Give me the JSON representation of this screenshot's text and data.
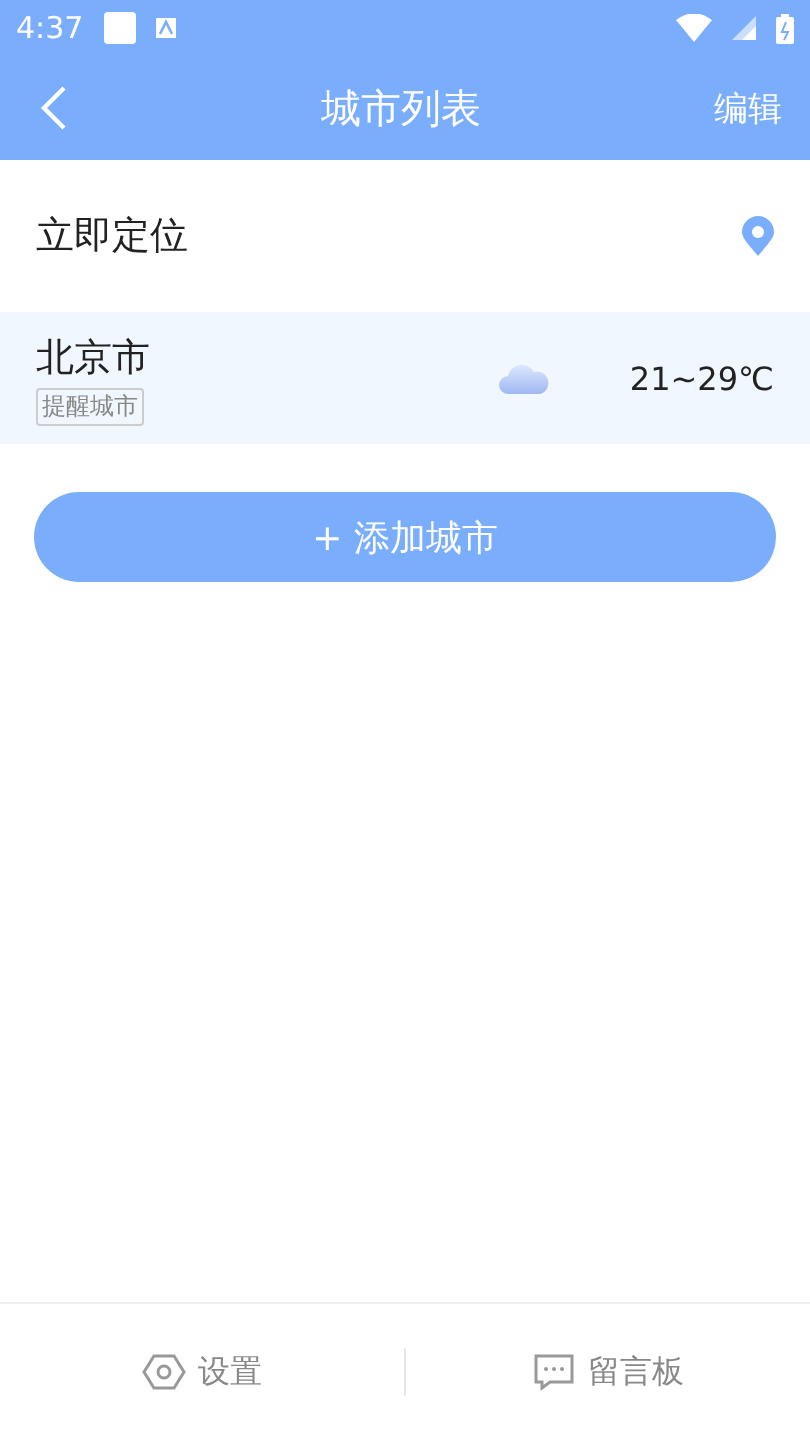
{
  "status_bar": {
    "time": "4:37"
  },
  "header": {
    "title": "城市列表",
    "action": "编辑"
  },
  "locate": {
    "label": "立即定位"
  },
  "cities": [
    {
      "name": "北京市",
      "tag": "提醒城市",
      "temperature": "21~29℃"
    }
  ],
  "add_button": {
    "label": "+ 添加城市"
  },
  "bottom_tabs": [
    {
      "label": "设置",
      "kind": "settings"
    },
    {
      "label": "留言板",
      "kind": "message"
    }
  ]
}
